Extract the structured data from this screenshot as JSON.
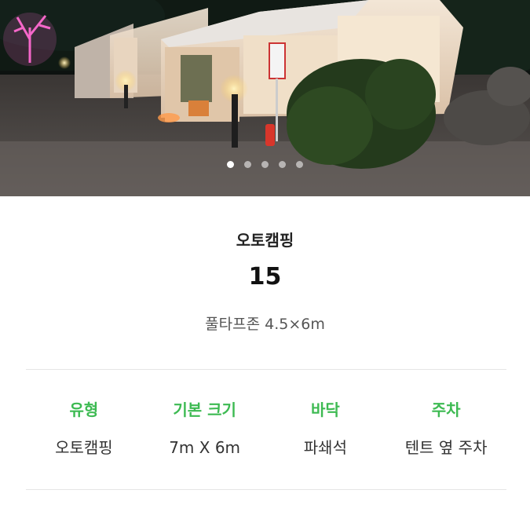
{
  "hero": {
    "image_label": "camping-site-photo",
    "slide_count": 5,
    "active_slide": 1
  },
  "site": {
    "category": "오토캠핑",
    "number": "15",
    "zone": "풀타프존 4.5×6m"
  },
  "specs": [
    {
      "label": "유형",
      "value": "오토캠핑"
    },
    {
      "label": "기본 크기",
      "value": "7m X 6m"
    },
    {
      "label": "바닥",
      "value": "파쇄석"
    },
    {
      "label": "주차",
      "value": "텐트 옆 주차"
    }
  ],
  "colors": {
    "accent_green": "#3dba52",
    "text_dark": "#222222",
    "text_muted": "#555555",
    "divider": "#e6e6e6"
  }
}
